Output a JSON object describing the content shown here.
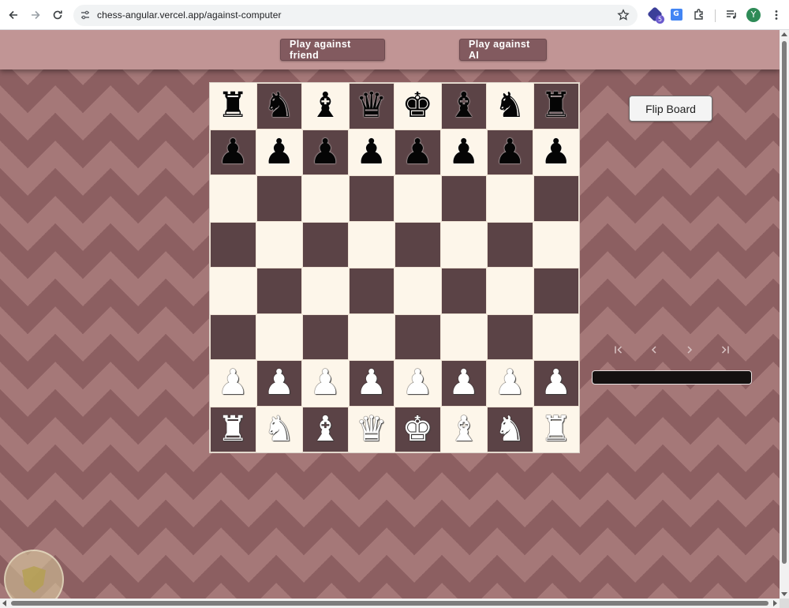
{
  "browser": {
    "url": "chess-angular.vercel.app/against-computer",
    "extension_badge": "5",
    "translate_label": "G",
    "profile_initial": "Y"
  },
  "nav": {
    "play_friend_label": "Play against friend",
    "play_ai_label": "Play against AI"
  },
  "board": {
    "orientation": "white-bottom",
    "light_color": "#fdf6ea",
    "dark_color": "#5b4346",
    "rows": [
      [
        {
          "g": "♜",
          "c": "black"
        },
        {
          "g": "♞",
          "c": "black"
        },
        {
          "g": "♝",
          "c": "black"
        },
        {
          "g": "♛",
          "c": "black"
        },
        {
          "g": "♚",
          "c": "black"
        },
        {
          "g": "♝",
          "c": "black"
        },
        {
          "g": "♞",
          "c": "black"
        },
        {
          "g": "♜",
          "c": "black"
        }
      ],
      [
        {
          "g": "♟",
          "c": "black"
        },
        {
          "g": "♟",
          "c": "black"
        },
        {
          "g": "♟",
          "c": "black"
        },
        {
          "g": "♟",
          "c": "black"
        },
        {
          "g": "♟",
          "c": "black"
        },
        {
          "g": "♟",
          "c": "black"
        },
        {
          "g": "♟",
          "c": "black"
        },
        {
          "g": "♟",
          "c": "black"
        }
      ],
      [
        null,
        null,
        null,
        null,
        null,
        null,
        null,
        null
      ],
      [
        null,
        null,
        null,
        null,
        null,
        null,
        null,
        null
      ],
      [
        null,
        null,
        null,
        null,
        null,
        null,
        null,
        null
      ],
      [
        null,
        null,
        null,
        null,
        null,
        null,
        null,
        null
      ],
      [
        {
          "g": "♟",
          "c": "white"
        },
        {
          "g": "♟",
          "c": "white"
        },
        {
          "g": "♟",
          "c": "white"
        },
        {
          "g": "♟",
          "c": "white"
        },
        {
          "g": "♟",
          "c": "white"
        },
        {
          "g": "♟",
          "c": "white"
        },
        {
          "g": "♟",
          "c": "white"
        },
        {
          "g": "♟",
          "c": "white"
        }
      ],
      [
        {
          "g": "♜",
          "c": "white"
        },
        {
          "g": "♞",
          "c": "white"
        },
        {
          "g": "♝",
          "c": "white"
        },
        {
          "g": "♛",
          "c": "white"
        },
        {
          "g": "♚",
          "c": "white"
        },
        {
          "g": "♝",
          "c": "white"
        },
        {
          "g": "♞",
          "c": "white"
        },
        {
          "g": "♜",
          "c": "white"
        }
      ]
    ]
  },
  "panel": {
    "flip_label": "Flip Board",
    "move_nav_icons": [
      "first-move-icon",
      "previous-move-icon",
      "next-move-icon",
      "last-move-icon"
    ]
  },
  "colors": {
    "page_light": "#a57878",
    "page_dark": "#8c5f61",
    "topbar": "#c19595",
    "nav_button": "#825a5f"
  }
}
